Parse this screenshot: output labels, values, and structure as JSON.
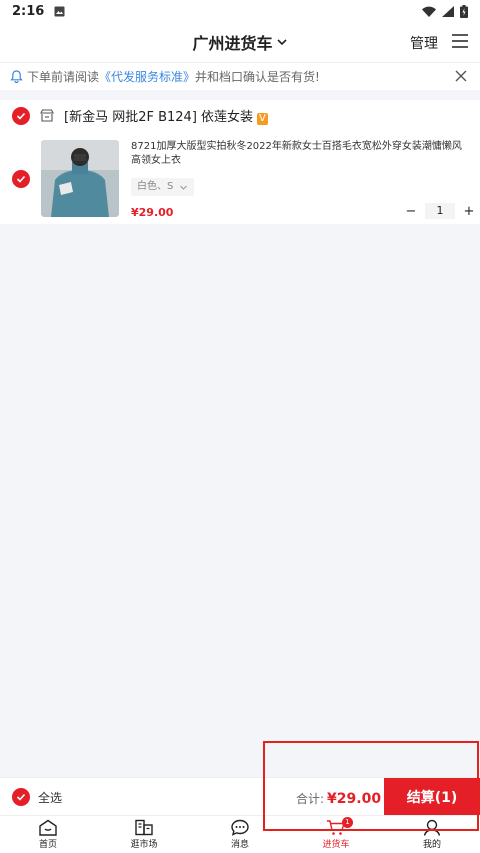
{
  "status_bar": {
    "time": "2:16"
  },
  "header": {
    "title": "广州进货车",
    "manage_label": "管理"
  },
  "notice": {
    "text_before": "下单前请阅读",
    "link_text": "《代发服务标准》",
    "text_after": "并和档口确认是否有货!"
  },
  "store": {
    "name": "[新金马 网批2F B124] 依莲女装",
    "badge": "V"
  },
  "item": {
    "name": "8721加厚大版型实拍秋冬2022年新款女士百搭毛衣宽松外穿女装潮慵懒风高领女上衣",
    "variant": "白色、S",
    "price": "¥29.00",
    "quantity": "1",
    "minus": "−",
    "plus": "+"
  },
  "bottom": {
    "select_all_label": "全选",
    "total_label": "合计:",
    "total_amount": "¥29.00",
    "checkout_label": "结算(1)"
  },
  "tabbar": {
    "tabs": [
      {
        "label": "首页",
        "icon": "home-icon"
      },
      {
        "label": "逛市场",
        "icon": "market-icon"
      },
      {
        "label": "消息",
        "icon": "message-icon"
      },
      {
        "label": "进货车",
        "icon": "cart-icon",
        "badge": "1"
      },
      {
        "label": "我的",
        "icon": "profile-icon"
      }
    ]
  },
  "colors": {
    "accent": "#e51f28",
    "link": "#3b87e0",
    "background": "#f3f5f8",
    "badge_orange": "#f59a23"
  }
}
